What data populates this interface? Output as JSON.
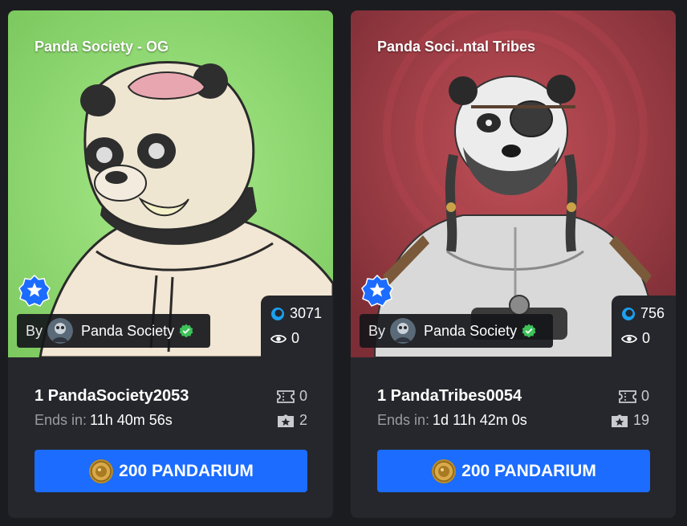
{
  "cards": [
    {
      "collection": "Panda Society - OG",
      "creator_prefix": "By",
      "creator": "Panda Society",
      "stats": {
        "likes": "3071",
        "views": "0"
      },
      "item_name": "1 PandaSociety2053",
      "ends_label": "Ends in:",
      "ends_value": "11h 40m 56s",
      "tickets": "0",
      "stars": "2",
      "price_label": "200 PANDARIUM",
      "art_bg": "#8fd875"
    },
    {
      "collection": "Panda Soci..ntal Tribes",
      "creator_prefix": "By",
      "creator": "Panda Society",
      "stats": {
        "likes": "756",
        "views": "0"
      },
      "item_name": "1 PandaTribes0054",
      "ends_label": "Ends in:",
      "ends_value": "1d 11h 42m 0s",
      "tickets": "0",
      "stars": "19",
      "price_label": "200 PANDARIUM",
      "art_bg": "#a8434a"
    }
  ],
  "colors": {
    "accent": "#1b6cff",
    "verified": "#3ec25a",
    "card_bg": "#26272c",
    "page_bg": "#1b1c20"
  },
  "icons": [
    "star-badge-icon",
    "verified-icon",
    "like-icon",
    "eye-icon",
    "ticket-icon",
    "star-box-icon",
    "coin-icon"
  ]
}
